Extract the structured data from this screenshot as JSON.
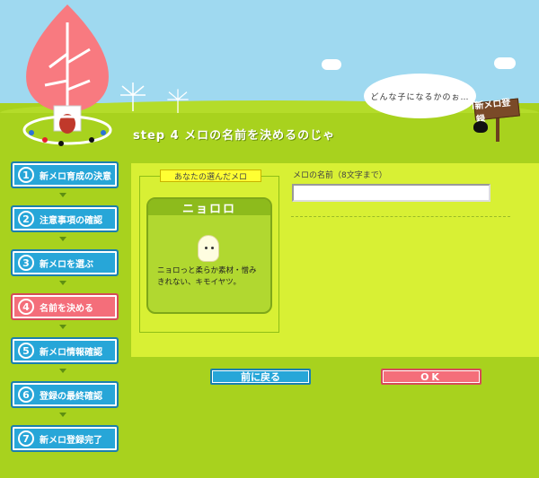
{
  "header": {
    "step_title": "step 4 メロの名前を決めるのじゃ",
    "speech_bubble": "どんな子になるかのぉ…",
    "sign_label": "新メロ登録"
  },
  "nav": {
    "items": [
      {
        "num": "1",
        "label": "新メロ育成の決意"
      },
      {
        "num": "2",
        "label": "注意事項の確認"
      },
      {
        "num": "3",
        "label": "新メロを選ぶ"
      },
      {
        "num": "4",
        "label": "名前を決める"
      },
      {
        "num": "5",
        "label": "新メロ情報確認"
      },
      {
        "num": "6",
        "label": "登録の最終確認"
      },
      {
        "num": "7",
        "label": "新メロ登録完了"
      }
    ]
  },
  "selected": {
    "box_label": "あなたの選んだメロ",
    "name": "ニョロロ",
    "description": "ニョロっと柔らか素材・憎みきれない、キモイヤツ。"
  },
  "form": {
    "name_label": "メロの名前（8文字まで）",
    "name_value": ""
  },
  "buttons": {
    "back_label": "前に戻る",
    "ok_label": "OK"
  },
  "colors": {
    "nav_default": "#27a6d8",
    "nav_active": "#f46e7a",
    "panel": "#d8f034",
    "ground": "#a8d21e",
    "sky": "#9fd9f0"
  }
}
